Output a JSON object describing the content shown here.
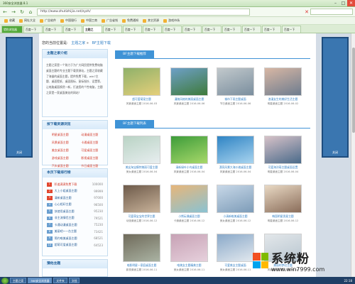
{
  "browser": {
    "title": "360安全浏览器 8.1",
    "url": "http://www.zhutizhijia.net/zyzh/",
    "nav_back": "←",
    "nav_forward": "→",
    "nav_refresh": "↻",
    "nav_home": "⌂",
    "close_x": "✕",
    "controls": {
      "minimize": "–",
      "maximize": "□",
      "close": "✕"
    },
    "favorites": [
      "收藏",
      "网址大全",
      "广告软件",
      "中国银行",
      "中国工商",
      "广告省钱",
      "免费通知",
      "其它资源",
      "游戏市场"
    ],
    "tabs": [
      {
        "label": "猎豹浏览器",
        "state": "first"
      },
      {
        "label": "百度一下",
        "state": "normal"
      },
      {
        "label": "百度一下",
        "state": "normal"
      },
      {
        "label": "百度一下",
        "state": "normal"
      },
      {
        "label": "主题之",
        "state": "active"
      },
      {
        "label": "百度一下",
        "state": "normal"
      },
      {
        "label": "百度一下",
        "state": "normal"
      },
      {
        "label": "百度一下",
        "state": "normal"
      },
      {
        "label": "百度一下",
        "state": "normal"
      },
      {
        "label": "百度一下",
        "state": "normal"
      },
      {
        "label": "百度一下",
        "state": "normal"
      },
      {
        "label": "百度一下",
        "state": "normal"
      },
      {
        "label": "百度一下",
        "state": "normal"
      },
      {
        "label": "百度一下",
        "state": "normal"
      },
      {
        "label": "百度一下",
        "state": "normal"
      }
    ]
  },
  "side_ads": {
    "close_label": "关闭"
  },
  "breadcrumb": {
    "prefix": "您的当前位置是:",
    "home": "主题之家",
    "sep": "»",
    "current": "BF主题下载"
  },
  "intro": {
    "title": "主题之家介绍",
    "text": "主题之家是一个致力于为广大网民提供免费电脑桌面主题的专业主题下载资源站，主题之家收藏了海量的桌面主题，提供免费下载，win7主题、桌面壁纸、桌面图标、鼠标指针、设置等，让电脑桌面焕然一新，打造您的个性电脑，主题之家是一家桌面美化的网站！"
  },
  "categories": {
    "title": "按下载资源浏览",
    "items": [
      "明星桌面主题",
      "动漫桌面主题",
      "风景桌面主题",
      "卡通桌面主题",
      "美女桌面主题",
      "可爱桌面主题",
      "游戏桌面主题",
      "影视桌面主题",
      "汽车桌面主题",
      "节日桌面主题"
    ]
  },
  "ranking": {
    "title": "本页下载排行榜",
    "items": [
      {
        "rank": "1",
        "name": "积道满满免费下载",
        "count": "100000",
        "hot": true
      },
      {
        "rank": "2",
        "name": "大上小姐桌面主题",
        "count": "99999",
        "hot": true
      },
      {
        "rank": "3",
        "name": "清新桌面主题",
        "count": "97000",
        "hot": true
      },
      {
        "rank": "4",
        "name": "心心相印主题",
        "count": "96500",
        "hot": false
      },
      {
        "rank": "5",
        "name": "快使用桌面主题",
        "count": "95230",
        "hot": false
      },
      {
        "rank": "6",
        "name": "非主流情侣主题",
        "count": "79521",
        "hot": false
      },
      {
        "rank": "7",
        "name": "卡通动漫桌面主题",
        "count": "75230",
        "hot": false
      },
      {
        "rank": "8",
        "name": "美丽吧~一台主题",
        "count": "73421",
        "hot": false
      },
      {
        "rank": "9",
        "name": "简约唯美桌面主题",
        "count": "68521",
        "hot": false
      },
      {
        "rank": "10",
        "name": "超萌可爱桌面主题",
        "count": "64523",
        "hot": false
      }
    ]
  },
  "tags": {
    "title": "猜他主题"
  },
  "section_recommend": "BF主题下载推荐",
  "section_list": "BF主题下载列表",
  "recommend": [
    {
      "name": "超可爱萌宠主题",
      "meta": "风景桌面主题  2016-06-03",
      "colors": [
        "#8fb16a",
        "#e5cf7a"
      ]
    },
    {
      "name": "漫随风格的美丽桌面主题",
      "meta": "风景桌面主题  2016-06-06",
      "colors": [
        "#6ea0c8",
        "#3e7a3a"
      ]
    },
    {
      "name": "城市下雨主题桌面",
      "meta": "节日桌面主题  2016-06-06",
      "colors": [
        "#c2c9cc",
        "#7a8e9e"
      ]
    },
    {
      "name": "浪漫女生的美好生活主题",
      "meta": "明星桌面主题  2016-06-02",
      "colors": [
        "#d8b7a4",
        "#6d7c8f"
      ]
    }
  ],
  "list": [
    {
      "name": "美女淘宝模特美丽可爱主题",
      "meta": "美女桌面主题  2016-06-04",
      "colors": [
        "#b9d3c4",
        "#e8eef0"
      ]
    },
    {
      "name": "清新绿叶小鸟桌面主题",
      "meta": "风景桌面主题  2016-06-04",
      "colors": [
        "#3d9c3a",
        "#a8d86a"
      ]
    },
    {
      "name": "漂亮风景大海沙滩桌面主题",
      "meta": "风景桌面主题  2016-06-04",
      "colors": [
        "#2f84c4",
        "#a9d4ef"
      ]
    },
    {
      "name": "可爱海洋萌主题桌面设置",
      "meta": "明星桌面主题  2016-06-04",
      "colors": [
        "#d7c2c8",
        "#4a6a8a"
      ]
    },
    {
      "name": "可爱萌宝宝的世界主题",
      "meta": "动漫桌面主题  2016-06-12",
      "colors": [
        "#6d5a4a",
        "#c9b39a"
      ]
    },
    {
      "name": "小熊玩偶桌面主题",
      "meta": "卡通桌面主题  2016-06-12",
      "colors": [
        "#e7b67a",
        "#8ac2d2"
      ]
    },
    {
      "name": "小清新唯美桌面主题",
      "meta": "美女桌面主题  2016-06-12",
      "colors": [
        "#c8d8e8",
        "#7d9cb8"
      ]
    },
    {
      "name": "韩国明星男星主题",
      "meta": "明星桌面主题  2016-06-12",
      "colors": [
        "#e9d9c4",
        "#8a6d5a"
      ]
    },
    {
      "name": "电影明星一家庭桌面主题",
      "meta": "影视桌面主题  2016-06-11",
      "colors": [
        "#6f6a5a",
        "#aab3a3"
      ]
    },
    {
      "name": "唯美女主题精美主题",
      "meta": "美女桌面主题  2016-06-11",
      "colors": [
        "#c7a2b5",
        "#e6d0dc"
      ]
    },
    {
      "name": "可爱美女主题桌面",
      "meta": "美女桌面主题  2016-06-11",
      "colors": [
        "#8aa9c9",
        "#e2e8ee"
      ]
    },
    {
      "name": "美丽的梦幻主题",
      "meta": "风景桌面主题  2016-06-11",
      "colors": [
        "#e3e7ea",
        "#b8c6d0"
      ]
    }
  ],
  "taskbar": {
    "buttons": [
      {
        "label": "主题之家",
        "active": false
      },
      {
        "label": "360安全浏览器",
        "active": true
      },
      {
        "label": "文件夹",
        "active": false
      },
      {
        "label": "文档",
        "active": false
      }
    ],
    "tray": "22:18"
  },
  "watermark": {
    "name": "系统粉",
    "domain": "www.win7999.com"
  }
}
